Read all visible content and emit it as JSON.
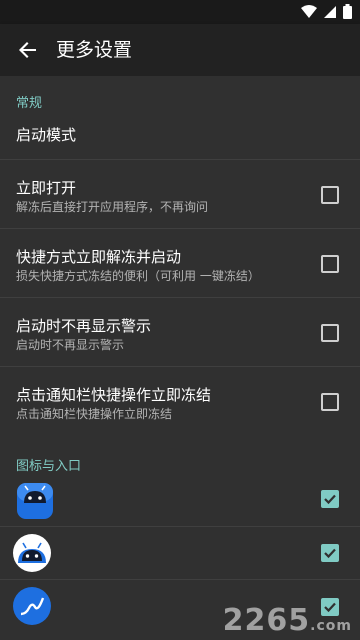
{
  "app_bar": {
    "title": "更多设置"
  },
  "sections": [
    {
      "header": "常规"
    },
    {
      "header": "图标与入口"
    }
  ],
  "launch_mode": {
    "label": "启动模式"
  },
  "prefs": [
    {
      "title": "立即打开",
      "summary": "解冻后直接打开应用程序，不再询问",
      "checked": false
    },
    {
      "title": "快捷方式立即解冻并启动",
      "summary": "损失快捷方式冻结的便利（可利用 一键冻结）",
      "checked": false
    },
    {
      "title": "启动时不再显示警示",
      "summary": "启动时不再显示警示",
      "checked": false
    },
    {
      "title": "点击通知栏快捷操作立即冻结",
      "summary": "点击通知栏快捷操作立即冻结",
      "checked": false
    }
  ],
  "icon_entries": [
    {
      "icon": "android-robot-square-icon",
      "checked": true
    },
    {
      "icon": "android-robot-circle-icon",
      "checked": true
    },
    {
      "icon": "trend-line-circle-icon",
      "checked": true
    }
  ],
  "watermark": {
    "text": "2265",
    "sub": ".com"
  },
  "colors": {
    "accent": "#80cbc4",
    "background": "#303030",
    "toolbar": "#222222"
  }
}
